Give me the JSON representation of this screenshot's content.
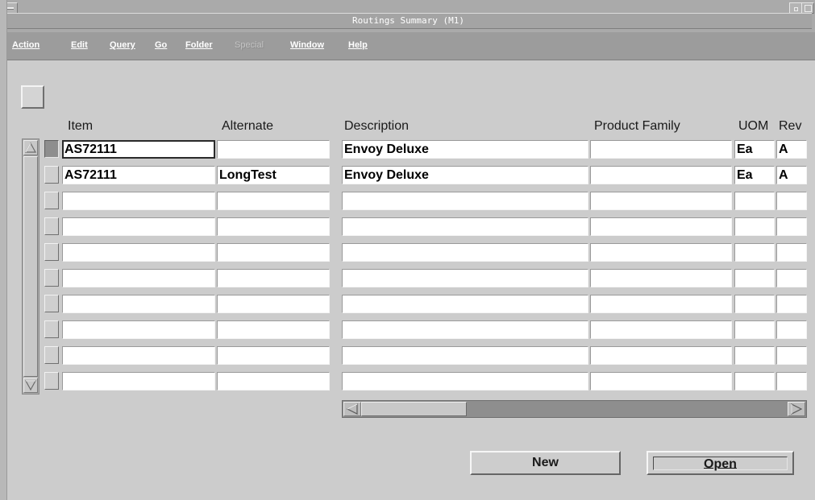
{
  "window": {
    "title": "Routings Summary (M1)"
  },
  "menubar": {
    "items": [
      {
        "label": "Action",
        "enabled": true
      },
      {
        "label": "Edit",
        "enabled": true
      },
      {
        "label": "Query",
        "enabled": true
      },
      {
        "label": "Go",
        "enabled": true
      },
      {
        "label": "Folder",
        "enabled": true
      },
      {
        "label": "Special",
        "enabled": false
      },
      {
        "label": "Window",
        "enabled": true
      },
      {
        "label": "Help",
        "enabled": true
      }
    ]
  },
  "table": {
    "columns": [
      "Item",
      "Alternate",
      "Description",
      "Product Family",
      "UOM",
      "Rev"
    ],
    "rows": [
      {
        "item": "AS72111",
        "alternate": "",
        "description": "Envoy Deluxe",
        "product_family": "",
        "uom": "Ea",
        "rev": "A"
      },
      {
        "item": "AS72111",
        "alternate": "LongTest",
        "description": "Envoy Deluxe",
        "product_family": "",
        "uom": "Ea",
        "rev": "A"
      },
      {
        "item": "",
        "alternate": "",
        "description": "",
        "product_family": "",
        "uom": "",
        "rev": ""
      },
      {
        "item": "",
        "alternate": "",
        "description": "",
        "product_family": "",
        "uom": "",
        "rev": ""
      },
      {
        "item": "",
        "alternate": "",
        "description": "",
        "product_family": "",
        "uom": "",
        "rev": ""
      },
      {
        "item": "",
        "alternate": "",
        "description": "",
        "product_family": "",
        "uom": "",
        "rev": ""
      },
      {
        "item": "",
        "alternate": "",
        "description": "",
        "product_family": "",
        "uom": "",
        "rev": ""
      },
      {
        "item": "",
        "alternate": "",
        "description": "",
        "product_family": "",
        "uom": "",
        "rev": ""
      },
      {
        "item": "",
        "alternate": "",
        "description": "",
        "product_family": "",
        "uom": "",
        "rev": ""
      },
      {
        "item": "",
        "alternate": "",
        "description": "",
        "product_family": "",
        "uom": "",
        "rev": ""
      }
    ],
    "current_row": 0
  },
  "buttons": {
    "new_label": "New",
    "open_label": "Open"
  }
}
